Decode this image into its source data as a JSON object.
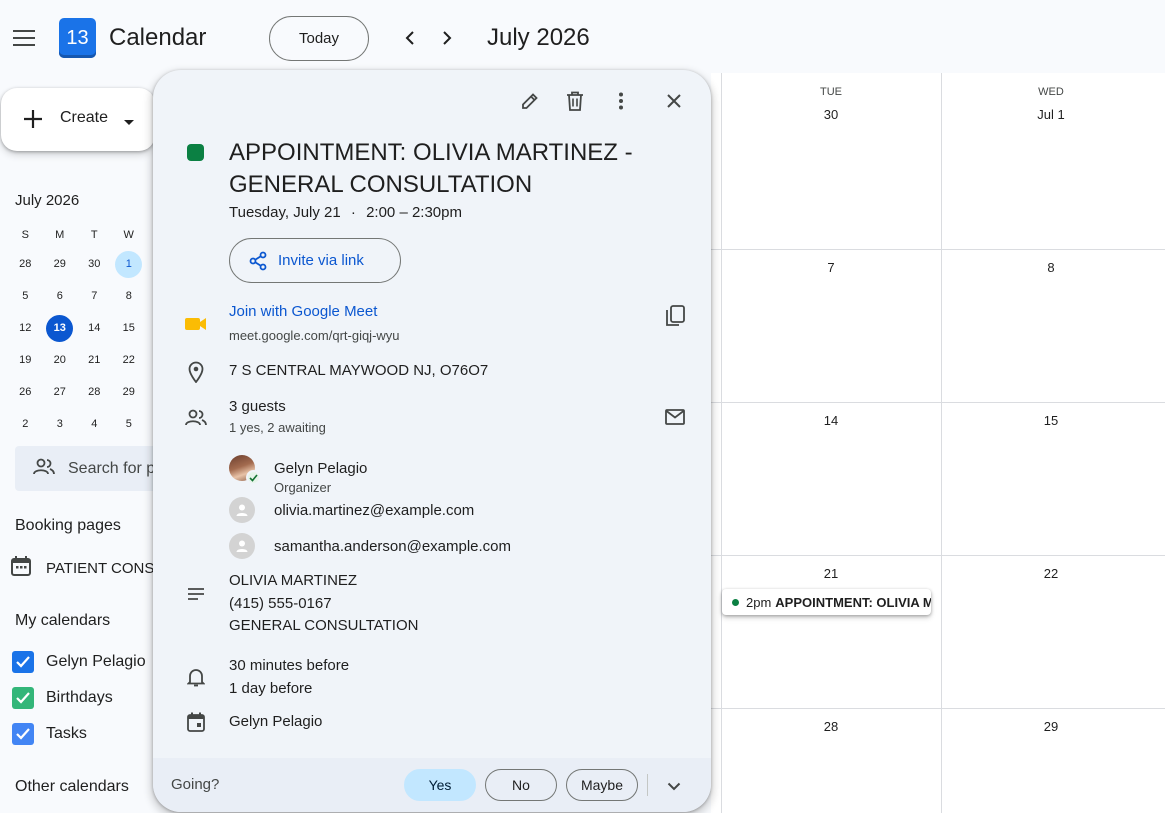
{
  "header": {
    "logo_text": "13",
    "app_title": "Calendar",
    "today_label": "Today",
    "month_title": "July 2026"
  },
  "sidebar": {
    "create_label": "Create",
    "mini_calendar": {
      "title": "July 2026",
      "weekdays": [
        "S",
        "M",
        "T",
        "W"
      ],
      "weeks": [
        [
          "28",
          "29",
          "30",
          "1"
        ],
        [
          "5",
          "6",
          "7",
          "8"
        ],
        [
          "12",
          "13",
          "14",
          "15"
        ],
        [
          "19",
          "20",
          "21",
          "22"
        ],
        [
          "26",
          "27",
          "28",
          "29"
        ],
        [
          "2",
          "3",
          "4",
          "5"
        ]
      ],
      "selected": "1",
      "today": "13"
    },
    "search_people_placeholder": "Search for p",
    "booking_pages_heading": "Booking pages",
    "booking_page_item": "PATIENT CONS",
    "my_calendars_heading": "My calendars",
    "my_calendars": [
      {
        "label": "Gelyn Pelagio",
        "color": "#1a73e8"
      },
      {
        "label": "Birthdays",
        "color": "#33b679"
      },
      {
        "label": "Tasks",
        "color": "#4285f4"
      }
    ],
    "other_calendars_heading": "Other calendars"
  },
  "grid": {
    "columns": [
      {
        "dow": "TUE",
        "date": "30"
      },
      {
        "dow": "WED",
        "date": "Jul 1"
      }
    ],
    "rows": [
      [
        "7",
        "8"
      ],
      [
        "14",
        "15"
      ],
      [
        "21",
        "22"
      ],
      [
        "28",
        "29"
      ]
    ],
    "event_chip": {
      "time": "2pm",
      "title": "APPOINTMENT: OLIVIA MARTINEZ - GENERAL CONSULTATION",
      "color": "#0b8043"
    }
  },
  "popup": {
    "title": "APPOINTMENT: OLIVIA MARTINEZ - GENERAL CONSULTATION",
    "event_color": "#0b8043",
    "date_text": "Tuesday, July 21",
    "separator": "·",
    "time_text": "2:00 – 2:30pm",
    "invite_label": "Invite via link",
    "meet_label": "Join with Google Meet",
    "meet_url": "meet.google.com/qrt-giqj-wyu",
    "location": "7 S CENTRAL MAYWOOD NJ, O76O7",
    "guests_count": "3 guests",
    "guests_summary": "1 yes, 2 awaiting",
    "guests": [
      {
        "name": "Gelyn Pelagio",
        "role": "Organizer"
      },
      {
        "name": "olivia.martinez@example.com"
      },
      {
        "name": "samantha.anderson@example.com"
      }
    ],
    "description": [
      "OLIVIA MARTINEZ",
      "(415) 555-0167",
      "GENERAL CONSULTATION"
    ],
    "reminders": [
      "30 minutes before",
      "1 day before"
    ],
    "calendar_owner": "Gelyn Pelagio",
    "rsvp": {
      "prompt": "Going?",
      "yes": "Yes",
      "no": "No",
      "maybe": "Maybe",
      "selected": "Yes"
    }
  }
}
